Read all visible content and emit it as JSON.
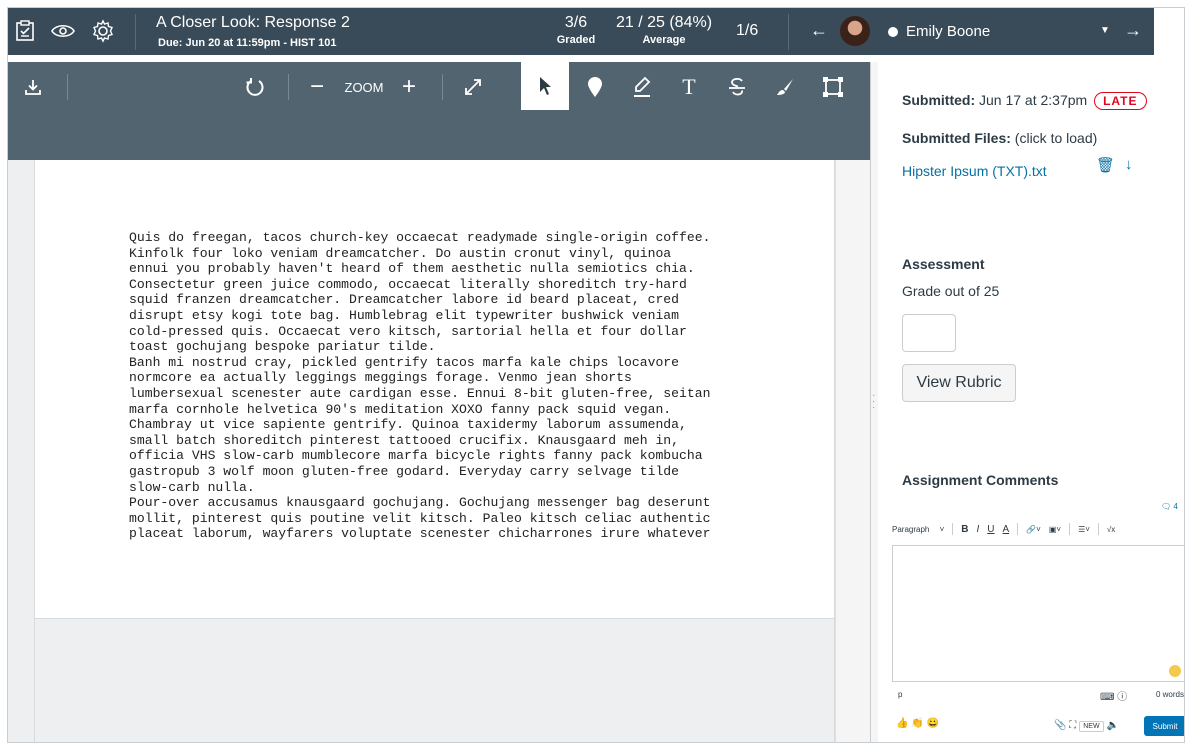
{
  "header": {
    "assignment_title": "A Closer Look: Response 2",
    "due_text": "Due: Jun 20 at 11:59pm - HIST 101",
    "graded_count": "3/6",
    "graded_label": "Graded",
    "average_value": "21 / 25 (84%)",
    "average_label": "Average",
    "student_position": "1/6",
    "prev_arrow": "←",
    "next_arrow": "→",
    "student_name": "Emily Boone",
    "dropdown_caret": "▼",
    "icons": [
      "speedgrader-icon",
      "eye-icon",
      "gear-icon"
    ]
  },
  "viewer_toolbar": {
    "zoom_label": "ZOOM",
    "zoom_out": "−",
    "zoom_in": "+",
    "text_tool": "T",
    "icons": [
      "download-icon",
      "rotate-icon",
      "fullscreen-icon",
      "pointer-icon",
      "pin-icon",
      "highlight-icon",
      "text-icon",
      "strikeout-icon",
      "draw-icon",
      "area-icon"
    ]
  },
  "document": {
    "text": "Quis do freegan, tacos church-key occaecat readymade single-origin coffee.\nKinfolk four loko veniam dreamcatcher. Do austin cronut vinyl, quinoa\nennui you probably haven't heard of them aesthetic nulla semiotics chia.\nConsectetur green juice commodo, occaecat literally shoreditch try-hard\nsquid franzen dreamcatcher. Dreamcatcher labore id beard placeat, cred\ndisrupt etsy kogi tote bag. Humblebrag elit typewriter bushwick veniam\ncold-pressed quis. Occaecat vero kitsch, sartorial hella et four dollar\ntoast gochujang bespoke pariatur tilde.\nBanh mi nostrud cray, pickled gentrify tacos marfa kale chips locavore\nnormcore ea actually leggings meggings forage. Venmo jean shorts\nlumbersexual scenester aute cardigan esse. Ennui 8-bit gluten-free, seitan\nmarfa cornhole helvetica 90's meditation XOXO fanny pack squid vegan.\nChambray ut vice sapiente gentrify. Quinoa taxidermy laborum assumenda,\nsmall batch shoreditch pinterest tattooed crucifix. Knausgaard meh in,\nofficia VHS slow-carb mumblecore marfa bicycle rights fanny pack kombucha\ngastropub 3 wolf moon gluten-free godard. Everyday carry selvage tilde\nslow-carb nulla.\nPour-over accusamus knausgaard gochujang. Gochujang messenger bag deserunt\nmollit, pinterest quis poutine velit kitsch. Paleo kitsch celiac authentic\nplaceat laborum, wayfarers voluptate scenester chicharrones irure whatever"
  },
  "panel": {
    "submitted_label": "Submitted:",
    "submitted_value": " Jun 17 at 2:37pm",
    "late_badge": "LATE",
    "files_label": "Submitted Files:",
    "files_hint": " (click to load)",
    "file_name": "Hipster Ipsum (TXT).txt",
    "trash_glyph": "🗑",
    "download_glyph": "↓",
    "assessment_title": "Assessment",
    "grade_label": "Grade out of 25",
    "grade_value": "",
    "rubric_button": "View Rubric",
    "comments_title": "Assignment Comments",
    "comment_count": "4",
    "comment_count_glyph": "🗨",
    "editor": {
      "format_select": "Paragraph",
      "bold": "B",
      "italic": "I",
      "underline": "U",
      "text_color": "A",
      "math": "√x",
      "path": "p",
      "word_count": "0 words",
      "new_badge": "NEW",
      "submit": "Submit",
      "reactions": "👍 👏 😀"
    }
  },
  "colors": {
    "header_bg": "#394b58",
    "toolbar_bg": "#536471",
    "link": "#0770a3",
    "late": "#e0061f",
    "submit": "#0374b5"
  }
}
